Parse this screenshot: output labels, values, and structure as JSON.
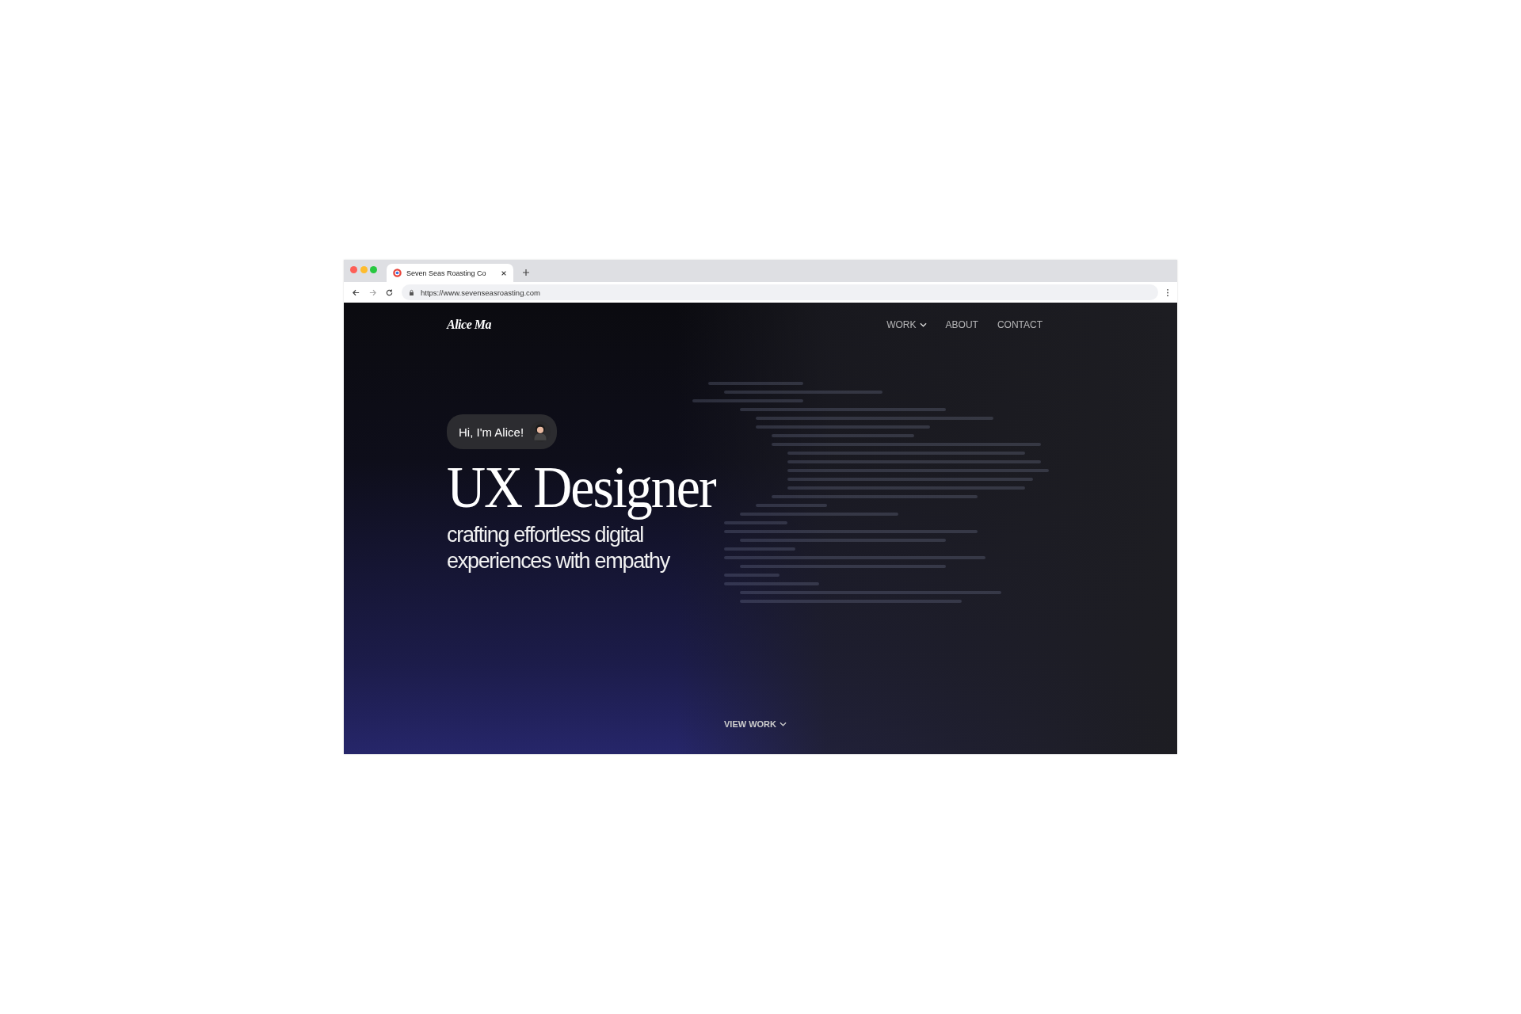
{
  "browser": {
    "tab": {
      "title": "Seven Seas Roasting Co",
      "selected": true
    },
    "address": "https://www.sevenseasroasting.com"
  },
  "site": {
    "logo": "Alice Ma",
    "nav": [
      {
        "label": "WORK",
        "kind": "dropdown"
      },
      {
        "label": "ABOUT",
        "kind": "link"
      },
      {
        "label": "CONTACT",
        "kind": "link"
      }
    ],
    "greeting": "Hi, I'm Alice!",
    "headline": "UX Designer",
    "tagline_lines": [
      "crafting effortless digital",
      "experiences with empathy"
    ],
    "cta": "VIEW WORK"
  }
}
